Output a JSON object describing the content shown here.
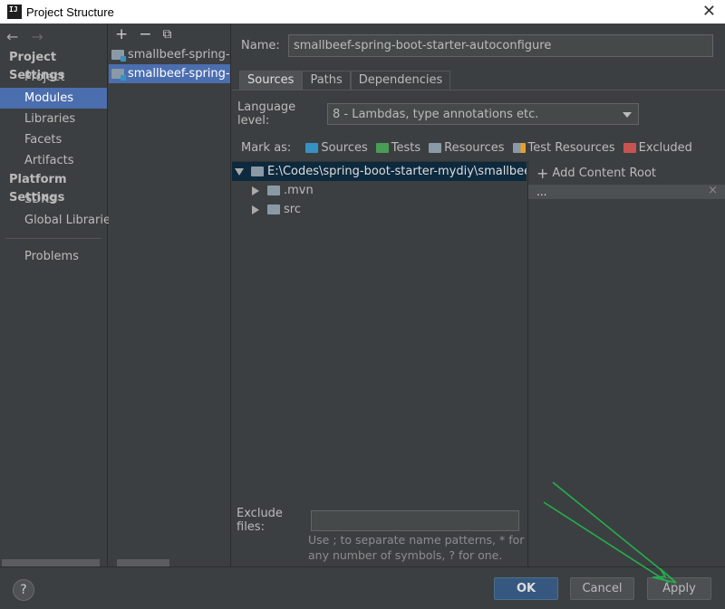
{
  "window": {
    "title": "Project Structure",
    "app_icon": "IJ"
  },
  "nav": {
    "back_icon": "←",
    "forward_icon": "→"
  },
  "sidebar": {
    "project_settings_header": "Project Settings",
    "project_settings_items": [
      {
        "label": "Project",
        "selected": false
      },
      {
        "label": "Modules",
        "selected": true
      },
      {
        "label": "Libraries",
        "selected": false
      },
      {
        "label": "Facets",
        "selected": false
      },
      {
        "label": "Artifacts",
        "selected": false
      }
    ],
    "platform_settings_header": "Platform Settings",
    "platform_settings_items": [
      {
        "label": "SDKs"
      },
      {
        "label": "Global Libraries"
      }
    ],
    "problems": "Problems"
  },
  "modules": {
    "toolbar": {
      "add": "+",
      "remove": "−",
      "copy": "⧉"
    },
    "items": [
      {
        "label": "smallbeef-spring-boot-starter",
        "selected": false
      },
      {
        "label": "smallbeef-spring-boot-starter-autoconfigure",
        "selected": true
      }
    ]
  },
  "name_field": {
    "label": "Name:",
    "value": "smallbeef-spring-boot-starter-autoconfigure"
  },
  "tabs": [
    {
      "label": "Sources",
      "active": true
    },
    {
      "label": "Paths",
      "active": false
    },
    {
      "label": "Dependencies",
      "active": false
    }
  ],
  "language_level": {
    "label": "Language level:",
    "value": "8 - Lambdas, type annotations etc."
  },
  "mark_as": {
    "label": "Mark as:",
    "items": [
      {
        "label": "Sources",
        "color": "#3592c4"
      },
      {
        "label": "Tests",
        "color": "#499c54"
      },
      {
        "label": "Resources",
        "color": "#8a99a6"
      },
      {
        "label": "Test Resources",
        "color": "#8a99a6"
      },
      {
        "label": "Excluded",
        "color": "#c75450"
      }
    ]
  },
  "tree": {
    "root": "E:\\Codes\\spring-boot-starter-mydiy\\smallbeef-spring-boot-starter-autoconfigure",
    "children": [
      ".mvn",
      "src"
    ]
  },
  "content_root": {
    "add_label": "Add Content Root",
    "root_bar": "...",
    "close": "×"
  },
  "exclude_files": {
    "label": "Exclude files:",
    "value": "",
    "hint": "Use ; to separate name patterns, * for any number of symbols, ? for one."
  },
  "buttons": {
    "help": "?",
    "ok": "OK",
    "cancel": "Cancel",
    "apply": "Apply"
  },
  "colors": {
    "selection": "#4b6eaf",
    "ok_button": "#365880",
    "annotation_arrow": "#22b14c"
  }
}
